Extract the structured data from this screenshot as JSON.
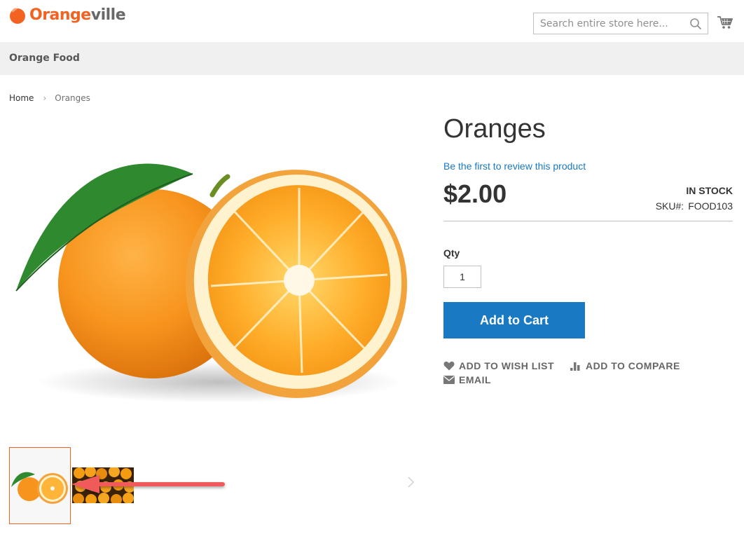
{
  "header": {
    "logo_part1": "Orange",
    "logo_part2": "ville",
    "search_placeholder": "Search entire store here..."
  },
  "nav": {
    "items": [
      {
        "label": "Orange Food"
      }
    ]
  },
  "breadcrumb": {
    "home": "Home",
    "separator": "›",
    "current": "Oranges"
  },
  "product": {
    "title": "Oranges",
    "review_link": "Be the first to review this product",
    "price": "$2.00",
    "stock": "IN STOCK",
    "sku_label": "SKU#:",
    "sku_value": "FOOD103",
    "qty_label": "Qty",
    "qty_value": "1",
    "add_to_cart": "Add to Cart"
  },
  "actions": {
    "wishlist": "ADD TO WISH LIST",
    "compare": "ADD TO COMPARE",
    "email": "EMAIL"
  },
  "colors": {
    "brand_orange": "#f26322",
    "link_blue": "#1979c3",
    "nav_bg": "#f0f0f0",
    "annotation_arrow": "#f05a5a"
  }
}
